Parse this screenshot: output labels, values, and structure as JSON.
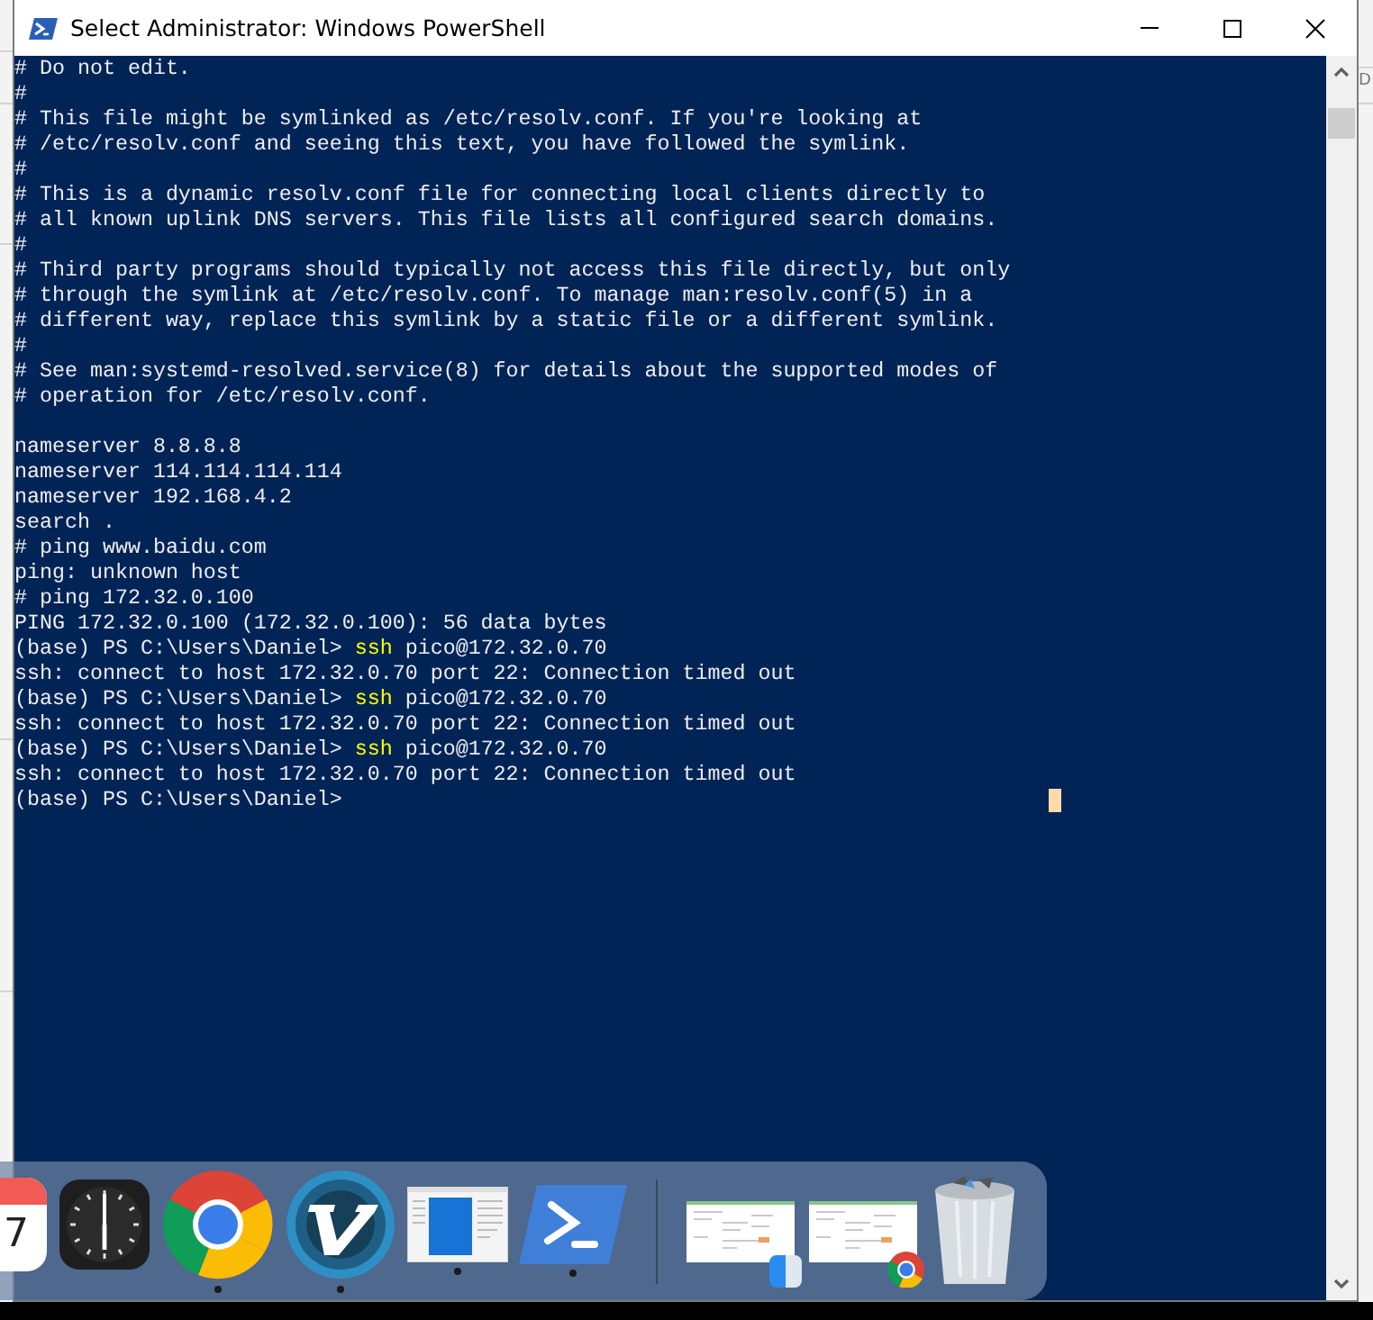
{
  "background": {
    "window_text": "D"
  },
  "window": {
    "title": "Select Administrator: Windows PowerShell"
  },
  "terminal": {
    "lines": [
      {
        "kind": "text",
        "text": "# Do not edit."
      },
      {
        "kind": "text",
        "text": "#"
      },
      {
        "kind": "text",
        "text": "# This file might be symlinked as /etc/resolv.conf. If you're looking at"
      },
      {
        "kind": "text",
        "text": "# /etc/resolv.conf and seeing this text, you have followed the symlink."
      },
      {
        "kind": "text",
        "text": "#"
      },
      {
        "kind": "text",
        "text": "# This is a dynamic resolv.conf file for connecting local clients directly to"
      },
      {
        "kind": "text",
        "text": "# all known uplink DNS servers. This file lists all configured search domains."
      },
      {
        "kind": "text",
        "text": "#"
      },
      {
        "kind": "text",
        "text": "# Third party programs should typically not access this file directly, but only"
      },
      {
        "kind": "text",
        "text": "# through the symlink at /etc/resolv.conf. To manage man:resolv.conf(5) in a"
      },
      {
        "kind": "text",
        "text": "# different way, replace this symlink by a static file or a different symlink."
      },
      {
        "kind": "text",
        "text": "#"
      },
      {
        "kind": "text",
        "text": "# See man:systemd-resolved.service(8) for details about the supported modes of"
      },
      {
        "kind": "text",
        "text": "# operation for /etc/resolv.conf."
      },
      {
        "kind": "blank"
      },
      {
        "kind": "text",
        "text": "nameserver 8.8.8.8"
      },
      {
        "kind": "text",
        "text": "nameserver 114.114.114.114"
      },
      {
        "kind": "text",
        "text": "nameserver 192.168.4.2"
      },
      {
        "kind": "text",
        "text": "search ."
      },
      {
        "kind": "text",
        "text": "# ping www.baidu.com"
      },
      {
        "kind": "text",
        "text": "ping: unknown host"
      },
      {
        "kind": "text",
        "text": "# ping 172.32.0.100"
      },
      {
        "kind": "text",
        "text": "PING 172.32.0.100 (172.32.0.100): 56 data bytes"
      },
      {
        "kind": "prompt",
        "prompt": "(base) PS C:\\Users\\Daniel>",
        "command": "ssh",
        "args": "pico@172.32.0.70"
      },
      {
        "kind": "text",
        "text": "ssh: connect to host 172.32.0.70 port 22: Connection timed out"
      },
      {
        "kind": "prompt",
        "prompt": "(base) PS C:\\Users\\Daniel>",
        "command": "ssh",
        "args": "pico@172.32.0.70"
      },
      {
        "kind": "text",
        "text": "ssh: connect to host 172.32.0.70 port 22: Connection timed out"
      },
      {
        "kind": "prompt",
        "prompt": "(base) PS C:\\Users\\Daniel>",
        "command": "ssh",
        "args": "pico@172.32.0.70"
      },
      {
        "kind": "text",
        "text": "ssh: connect to host 172.32.0.70 port 22: Connection timed out"
      },
      {
        "kind": "prompt",
        "prompt": "(base) PS C:\\Users\\Daniel>"
      }
    ]
  },
  "dock": {
    "items": [
      {
        "kind": "calendar",
        "day": "7",
        "running": false
      },
      {
        "kind": "clock",
        "running": false
      },
      {
        "kind": "browser",
        "running": true
      },
      {
        "kind": "vim",
        "running": true
      },
      {
        "kind": "preview",
        "running": true
      },
      {
        "kind": "powershell",
        "running": true
      },
      {
        "kind": "separator"
      },
      {
        "kind": "thumbnail",
        "badge": {
          "kind": "finder"
        }
      },
      {
        "kind": "thumbnail",
        "badge": {
          "kind": "browser"
        }
      },
      {
        "kind": "trash"
      }
    ]
  }
}
